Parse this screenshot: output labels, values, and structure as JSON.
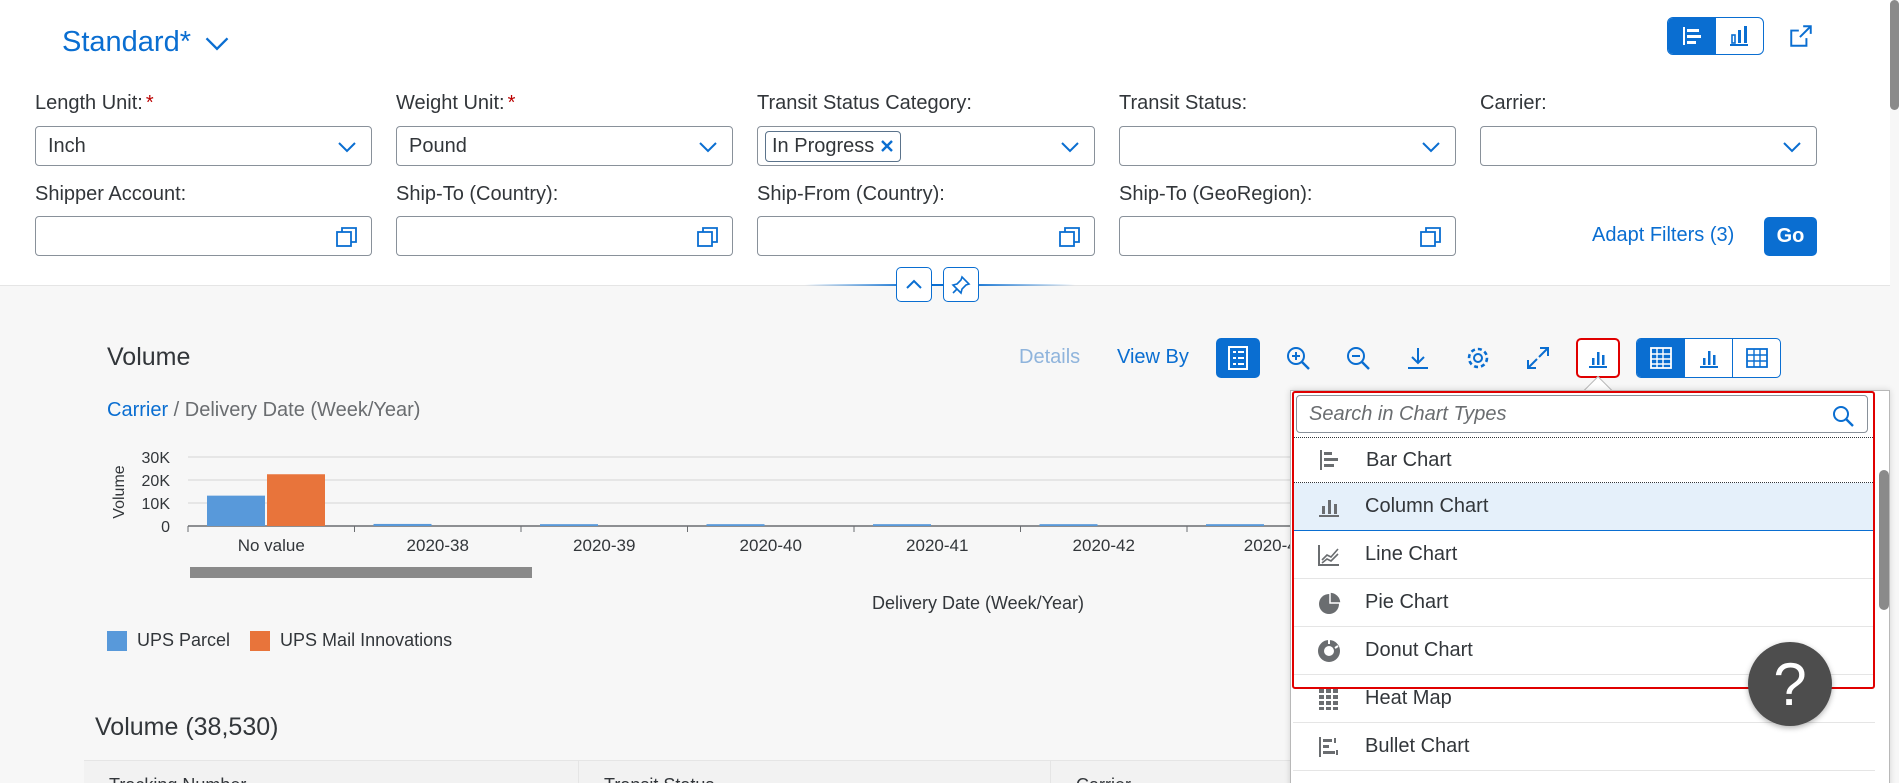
{
  "header": {
    "variant_title": "Standard*"
  },
  "filters": {
    "length_unit_label": "Length Unit:",
    "length_unit_value": "Inch",
    "weight_unit_label": "Weight Unit:",
    "weight_unit_value": "Pound",
    "required_marker": "*",
    "transit_category_label": "Transit Status Category:",
    "transit_category_token": "In Progress",
    "transit_status_label": "Transit Status:",
    "carrier_label": "Carrier:",
    "shipper_label": "Shipper Account:",
    "shipto_country_label": "Ship-To (Country):",
    "shipfrom_country_label": "Ship-From (Country):",
    "shipto_geo_label": "Ship-To (GeoRegion):",
    "adapt_filters": "Adapt Filters (3)",
    "go": "Go"
  },
  "card": {
    "title": "Volume",
    "details": "Details",
    "view_by": "View By",
    "crumb_link": "Carrier",
    "crumb_rest": " / Delivery Date (Week/Year)"
  },
  "chart_data": {
    "type": "bar",
    "categories": [
      "No value",
      "2020-38",
      "2020-39",
      "2020-40",
      "2020-41",
      "2020-42",
      "2020-4"
    ],
    "series": [
      {
        "name": "UPS Parcel",
        "color": "#5899da",
        "values": [
          13200,
          900,
          800,
          800,
          800,
          800,
          800
        ]
      },
      {
        "name": "UPS Mail Innovations",
        "color": "#e8743b",
        "values": [
          22500,
          0,
          0,
          0,
          0,
          0,
          0
        ]
      }
    ],
    "y_ticks": [
      "30K",
      "20K",
      "10K",
      "0"
    ],
    "ylim": [
      0,
      30000
    ],
    "xlabel": "Delivery Date (Week/Year)",
    "ylabel": "Volume"
  },
  "table": {
    "title": "Volume (38,530)",
    "col_tracking": "Tracking Number",
    "col_transit": "Transit Status",
    "col_carrier": "Carrier"
  },
  "popover": {
    "search_placeholder": "Search in Chart Types",
    "items": [
      "Bar Chart",
      "Column Chart",
      "Line Chart",
      "Pie Chart",
      "Donut Chart",
      "Heat Map",
      "Bullet Chart"
    ]
  },
  "help": "?"
}
